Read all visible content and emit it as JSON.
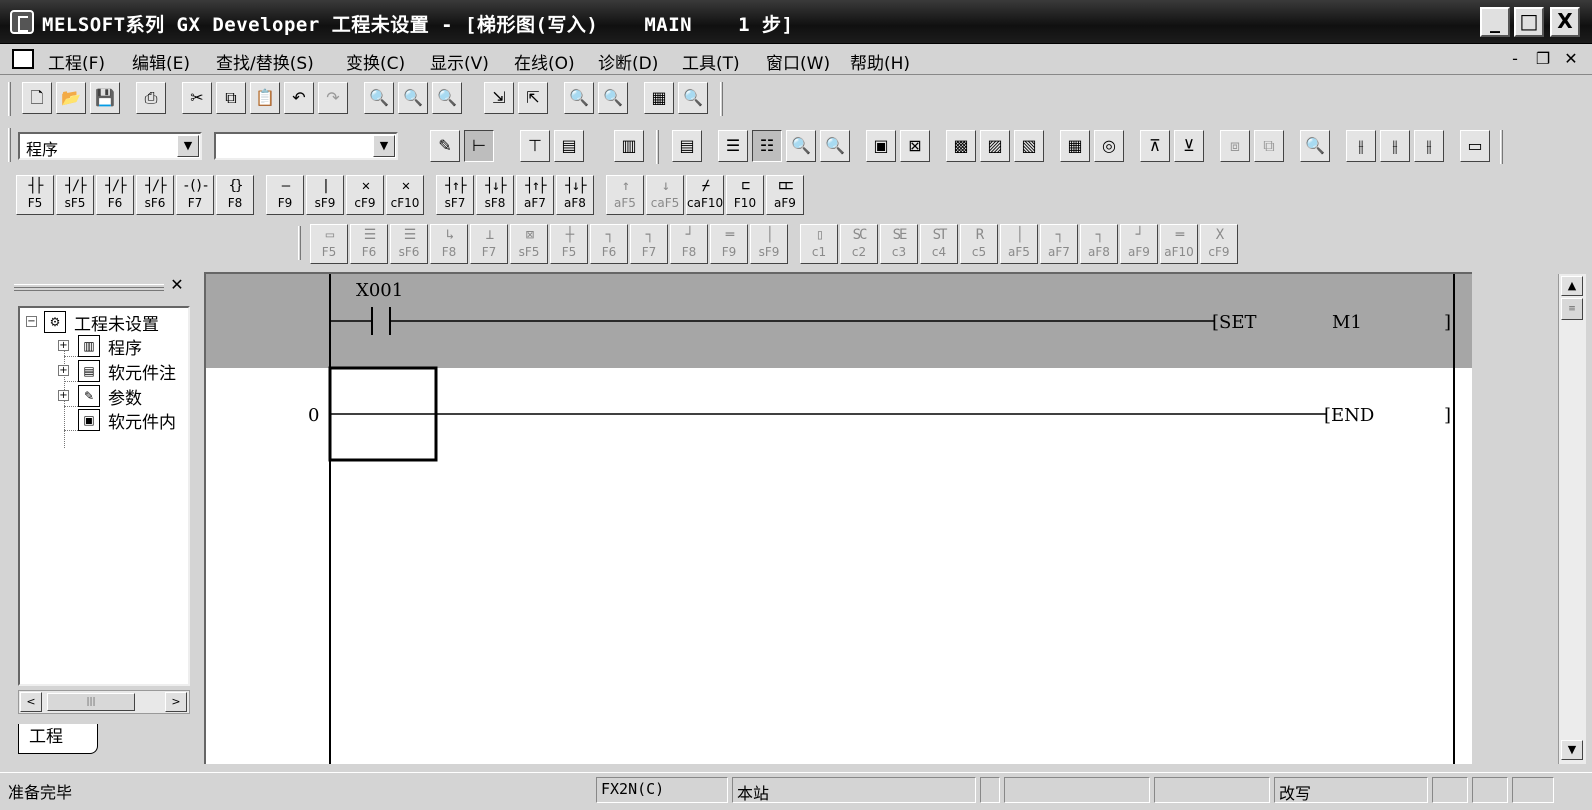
{
  "window": {
    "title_app": "MELSOFT系列 GX Developer 工程未设置 - [梯形图(写入)",
    "title_program": "MAIN",
    "title_steps": "1 步]",
    "minimize": "_",
    "maximize": "□",
    "close": "X"
  },
  "menu": {
    "items": [
      "工程(F)",
      "编辑(E)",
      "查找/替换(S)",
      "变换(C)",
      "显示(V)",
      "在线(O)",
      "诊断(D)",
      "工具(T)",
      "窗口(W)",
      "帮助(H)"
    ],
    "mdi_minimize": "-",
    "mdi_restore": "❐",
    "mdi_close": "✕"
  },
  "toolbar": {
    "data_type_combo": "程序",
    "second_combo": ""
  },
  "ladder_keys": [
    {
      "sym": "┤├",
      "label": "F5"
    },
    {
      "sym": "┤/├",
      "label": "sF5"
    },
    {
      "sym": "┤/├",
      "label": "F6"
    },
    {
      "sym": "┤/├",
      "label": "sF6"
    },
    {
      "sym": "-()-",
      "label": "F7"
    },
    {
      "sym": "{}",
      "label": "F8"
    },
    {
      "sym": "—",
      "label": "F9"
    },
    {
      "sym": "|",
      "label": "sF9"
    },
    {
      "sym": "✕",
      "label": "cF9"
    },
    {
      "sym": "✕",
      "label": "cF10"
    },
    {
      "sym": "┤↑├",
      "label": "sF7"
    },
    {
      "sym": "┤↓├",
      "label": "sF8"
    },
    {
      "sym": "┤↑├",
      "label": "aF7"
    },
    {
      "sym": "┤↓├",
      "label": "aF8"
    },
    {
      "sym": "↑",
      "label": "aF5"
    },
    {
      "sym": "↓",
      "label": "caF5"
    },
    {
      "sym": "⌿",
      "label": "caF10"
    },
    {
      "sym": "⊏",
      "label": "F10"
    },
    {
      "sym": "⊏⊏",
      "label": "aF9"
    }
  ],
  "sfc_keys": [
    "F5",
    "F6",
    "sF6",
    "F8",
    "F7",
    "sF5",
    "F5",
    "F6",
    "F7",
    "F8",
    "F9",
    "sF9",
    "c1",
    "c2",
    "c3",
    "c4",
    "c5",
    "aF5",
    "aF7",
    "aF8",
    "aF9",
    "aF10",
    "cF9"
  ],
  "project_panel": {
    "close": "✕",
    "root": "工程未设置",
    "children": [
      "程序",
      "软元件注",
      "参数",
      "软元件内"
    ],
    "tab": "工程",
    "scroll_left": "<",
    "scroll_right": ">"
  },
  "ladder": {
    "contact_device": "X001",
    "instruction_1": "[SET",
    "operand_1": "M1",
    "close_bracket": "]",
    "step_number": "0",
    "instruction_2": "[END"
  },
  "vscroll": {
    "up": "▲",
    "down": "▼"
  },
  "status": {
    "ready": "准备完毕",
    "plc_type": "FX2N(C)",
    "station": "本站",
    "mode": "改写"
  }
}
